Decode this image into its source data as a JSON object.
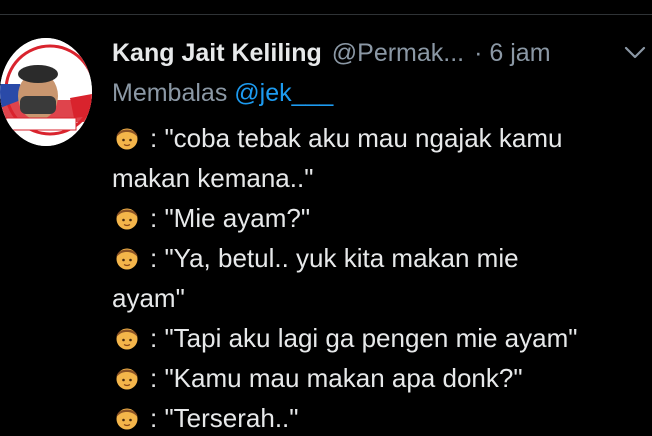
{
  "tweet": {
    "display_name": "Kang Jait Keliling",
    "handle": "@Permak...",
    "time": "· 6 jam",
    "replying_label": "Membalas",
    "replying_to": "@jek___",
    "avatar_text": {
      "arc": "BAHASA INDONESIA",
      "banner": "SAYA DUKUNG"
    },
    "lines": [
      {
        "emoji": "boy-emoji",
        "text": ": \"coba tebak aku mau ngajak kamu"
      },
      {
        "emoji": null,
        "text": "makan kemana..\""
      },
      {
        "emoji": "boy-emoji",
        "text": ": \"Mie ayam?\""
      },
      {
        "emoji": "boy-emoji",
        "text": ": \"Ya, betul.. yuk kita makan mie"
      },
      {
        "emoji": null,
        "text": "ayam\""
      },
      {
        "emoji": "boy-emoji",
        "text": ": \"Tapi aku lagi ga pengen mie ayam\""
      },
      {
        "emoji": "boy-emoji",
        "text": ": \"Kamu mau makan apa donk?\""
      },
      {
        "emoji": "boy-emoji",
        "text": ": \"Terserah..\""
      }
    ]
  },
  "colors": {
    "background": "#000000",
    "text": "#e7e9ea",
    "muted": "#8b98a5",
    "link": "#1d9bf0"
  }
}
